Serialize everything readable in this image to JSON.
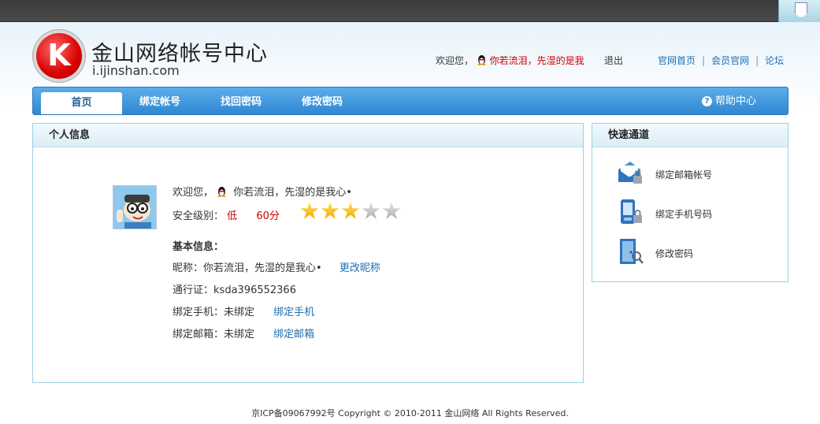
{
  "header": {
    "site_title": "金山网络帐号中心",
    "site_domain": "i.ijinshan.com",
    "logo_letter": "K",
    "welcome": "欢迎您，",
    "username": "你若流泪，先湿的是我",
    "logout": "退出",
    "links": [
      "官网首页",
      "会员官网",
      "论坛"
    ],
    "separator": "|"
  },
  "nav": {
    "tabs": [
      "首页",
      "绑定帐号",
      "找回密码",
      "修改密码"
    ],
    "active_tab": "首页",
    "help": "帮助中心"
  },
  "personal": {
    "title": "个人信息",
    "welcome_prefix": "欢迎您，",
    "welcome_name": "你若流泪，先湿的是我心•",
    "security_label": "安全级别：",
    "security_level": "低",
    "security_score": "60分",
    "stars_filled": 3,
    "stars_total": 5,
    "basic_title": "基本信息：",
    "nickname_label": "昵称：",
    "nickname_value": "你若流泪，先湿的是我心•",
    "change_nickname": "更改昵称",
    "passport_label": "通行证：",
    "passport_value": "ksda396552366",
    "phone_label": "绑定手机：",
    "phone_value": "未绑定",
    "bind_phone": "绑定手机",
    "email_label": "绑定邮箱：",
    "email_value": "未绑定",
    "bind_email": "绑定邮箱"
  },
  "quick": {
    "title": "快速通道",
    "items": [
      {
        "label": "绑定邮箱帐号",
        "icon": "email-lock-icon"
      },
      {
        "label": "绑定手机号码",
        "icon": "phone-lock-icon"
      },
      {
        "label": "修改密码",
        "icon": "door-key-icon"
      }
    ]
  },
  "footer": {
    "text": "京ICP备09067992号 Copyright © 2010-2011 金山网络 All Rights Reserved."
  },
  "colors": {
    "nav_blue": "#2f87d4",
    "link_blue": "#1f6fb0",
    "warning_red": "#cc0000",
    "star_gold": "#f4a400"
  }
}
